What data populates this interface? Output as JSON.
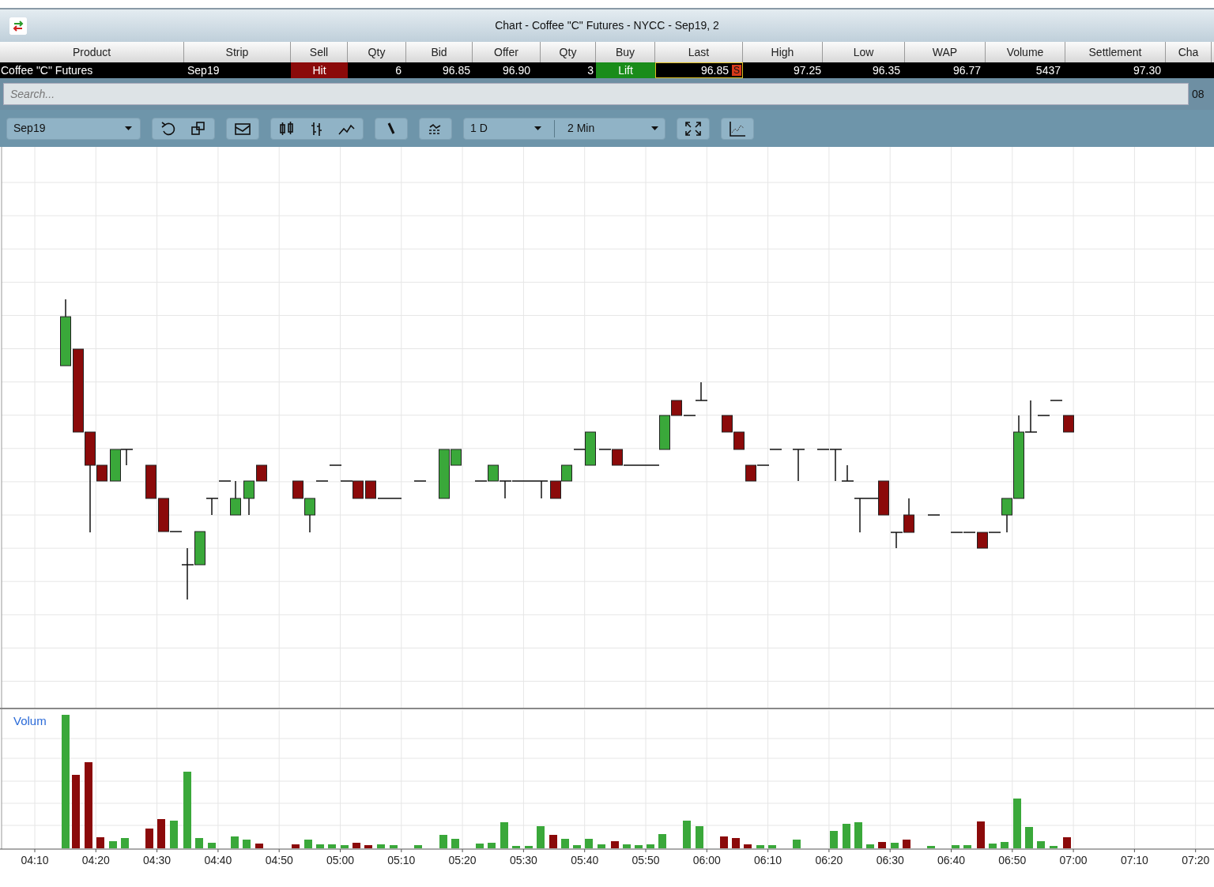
{
  "window": {
    "title": "Chart - Coffee \"C\" Futures - NYCC - Sep19, 2"
  },
  "table": {
    "columns": [
      "Product",
      "Strip",
      "Sell",
      "Qty",
      "Bid",
      "Offer",
      "Qty",
      "Buy",
      "Last",
      "High",
      "Low",
      "WAP",
      "Volume",
      "Settlement",
      "Cha"
    ],
    "row": {
      "product": "Coffee \"C\" Futures",
      "strip": "Sep19",
      "sell": "Hit",
      "sell_qty": "6",
      "bid": "96.85",
      "offer": "96.90",
      "buy_qty": "3",
      "buy": "Lift",
      "last": "96.85",
      "last_flag": "S",
      "high": "97.25",
      "low": "96.35",
      "wap": "96.77",
      "volume": "5437",
      "settlement": "97.30"
    }
  },
  "search": {
    "placeholder": "Search...",
    "side_text": "08"
  },
  "toolbar": {
    "strip_select": "Sep19",
    "range_select": "1 D",
    "interval_select": "2 Min"
  },
  "volume_panel": {
    "label": "Volum"
  },
  "x_axis_labels": [
    "04:10",
    "04:20",
    "04:30",
    "04:40",
    "04:50",
    "05:00",
    "05:10",
    "05:20",
    "05:30",
    "05:40",
    "05:50",
    "06:00",
    "06:10",
    "06:20",
    "06:30",
    "06:40",
    "06:50",
    "07:00",
    "07:10",
    "07:20"
  ]
}
